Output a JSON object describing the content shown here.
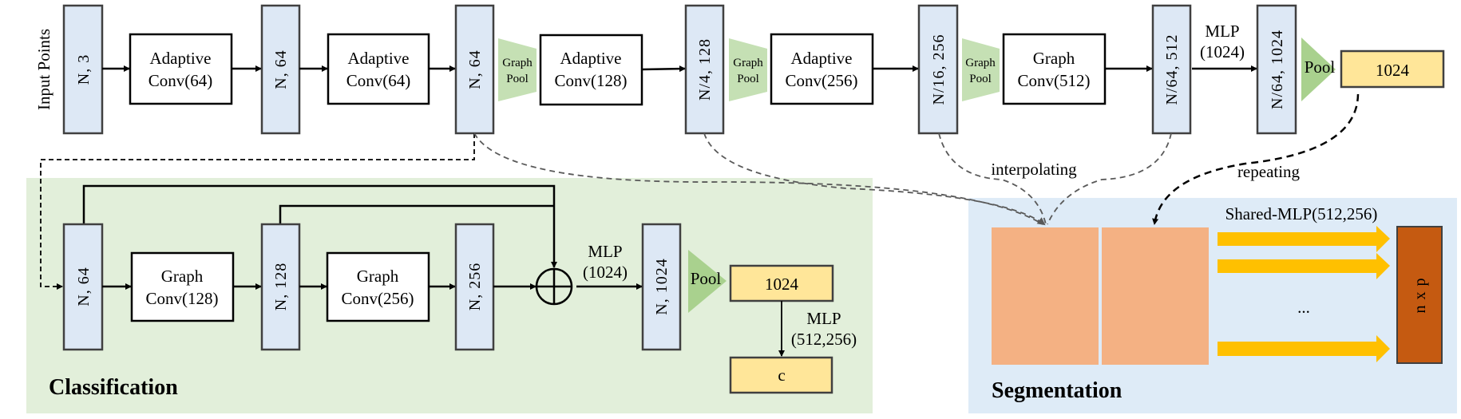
{
  "input_label": "Input Points",
  "top_row": {
    "tensors": [
      "N, 3",
      "N, 64",
      "N, 64",
      "N/4, 128",
      "N/16, 256",
      "N/64, 512",
      "N/64, 1024"
    ],
    "ops": [
      {
        "line1": "Adaptive",
        "line2": "Conv(64)"
      },
      {
        "line1": "Adaptive",
        "line2": "Conv(64)"
      },
      {
        "line1": "Adaptive",
        "line2": "Conv(128)"
      },
      {
        "line1": "Adaptive",
        "line2": "Conv(256)"
      },
      {
        "line1": "Graph",
        "line2": "Conv(512)"
      }
    ],
    "graph_pool": {
      "line1": "Graph",
      "line2": "Pool"
    },
    "mlp": {
      "line1": "MLP",
      "line2": "(1024)"
    },
    "pool": "Pool",
    "global_feature": "1024"
  },
  "classification": {
    "title": "Classification",
    "tensors": [
      "N, 64",
      "N, 128",
      "N, 256",
      "N, 1024"
    ],
    "ops": [
      {
        "line1": "Graph",
        "line2": "Conv(128)"
      },
      {
        "line1": "Graph",
        "line2": "Conv(256)"
      }
    ],
    "mlp": {
      "line1": "MLP",
      "line2": "(1024)"
    },
    "pool": "Pool",
    "global_feature": "1024",
    "mlp2": {
      "line1": "MLP",
      "line2": "(512,256)"
    },
    "output": "c",
    "background": "#e2efda"
  },
  "segmentation": {
    "title": "Segmentation",
    "interpolating": "interpolating",
    "repeating": "repeating",
    "shared_mlp": "Shared-MLP(512,256)",
    "ellipsis": "...",
    "output": "n x p",
    "background": "#deebf7",
    "feature_color": "#f4b183",
    "arrow_color": "#ffc000",
    "output_color": "#c55a11"
  }
}
